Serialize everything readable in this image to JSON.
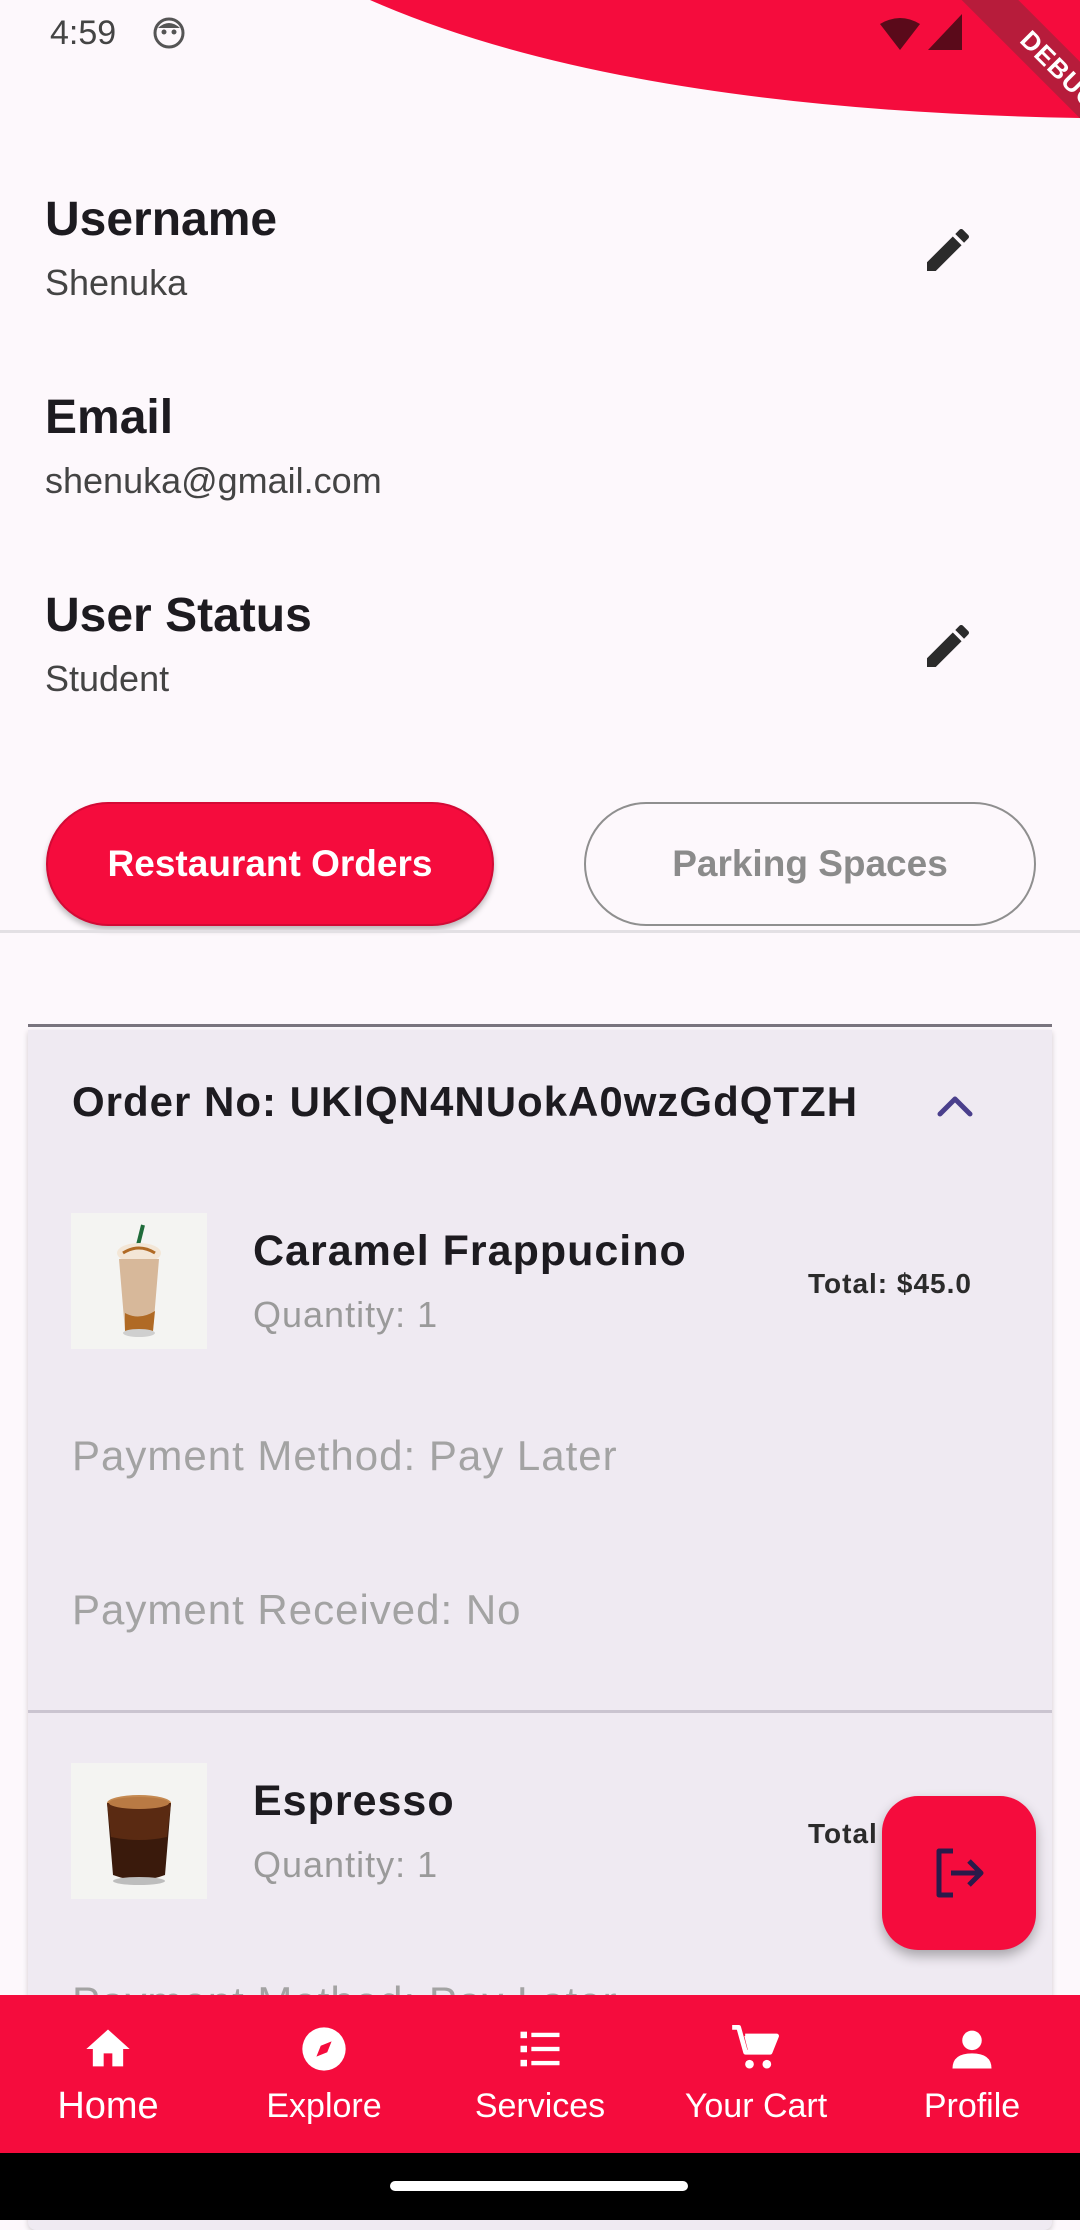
{
  "status_bar": {
    "time": "4:59",
    "debug_label": "DEBUG"
  },
  "profile": {
    "username_label": "Username",
    "username_value": "Shenuka",
    "email_label": "Email",
    "email_value": "shenuka@gmail.com",
    "status_label": "User Status",
    "status_value": "Student"
  },
  "tabs": {
    "restaurant_label": "Restaurant Orders",
    "parking_label": "Parking Spaces",
    "active": "Restaurant Orders"
  },
  "order": {
    "title": "Order No: UKlQN4NUokA0wzGdQTZH",
    "items": [
      {
        "name": "Caramel Frappucino",
        "quantity": "Quantity: 1",
        "total": "Total: $45.0",
        "payment_method": "Payment Method: Pay Later",
        "payment_received": "Payment Received: No"
      },
      {
        "name": "Espresso",
        "quantity": "Quantity: 1",
        "total": "Total",
        "payment_method": "Payment Method: Pay Later"
      }
    ]
  },
  "nav": {
    "items": [
      {
        "label": "Home",
        "icon": "home-icon"
      },
      {
        "label": "Explore",
        "icon": "compass-icon"
      },
      {
        "label": "Services",
        "icon": "list-icon"
      },
      {
        "label": "Your Cart",
        "icon": "cart-icon"
      },
      {
        "label": "Profile",
        "icon": "person-icon"
      }
    ],
    "active": "Home"
  },
  "colors": {
    "accent": "#f50c3d",
    "card_bg": "#efeaf2",
    "page_bg": "#fdf8fc"
  }
}
